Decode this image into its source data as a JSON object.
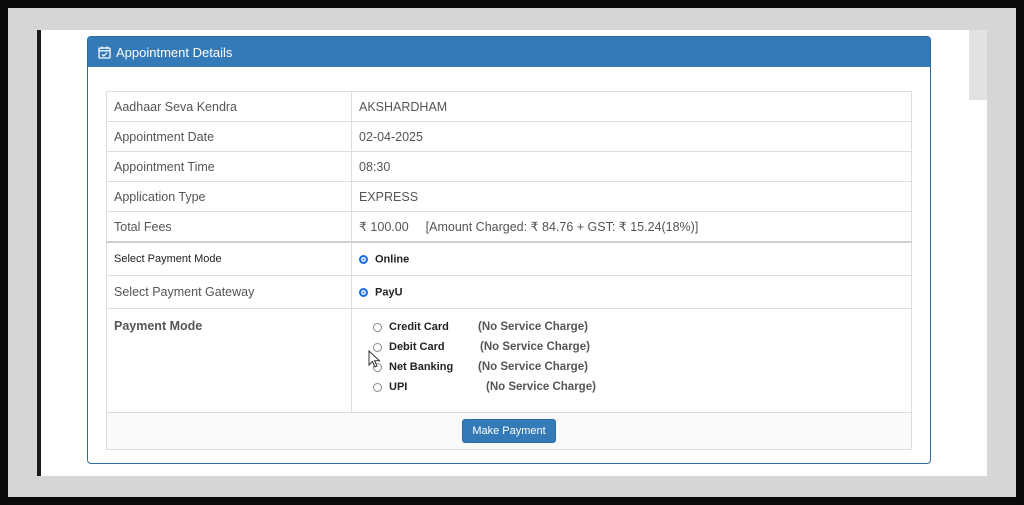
{
  "panel": {
    "title": "Appointment Details",
    "icon": "calendar-check-icon"
  },
  "details": [
    {
      "label": "Aadhaar Seva Kendra",
      "value": "AKSHARDHAM"
    },
    {
      "label": "Appointment Date",
      "value": "02-04-2025"
    },
    {
      "label": "Appointment Time",
      "value": "08:30"
    },
    {
      "label": "Application Type",
      "value": "EXPRESS"
    }
  ],
  "fees": {
    "label": "Total Fees",
    "amount": "₹ 100.00",
    "breakdown": "[Amount Charged: ₹ 84.76 + GST: ₹ 15.24(18%)]"
  },
  "payment_mode_select": {
    "label": "Select Payment Mode",
    "option": "Online",
    "selected": true
  },
  "gateway_select": {
    "label": "Select Payment Gateway",
    "option": "PayU",
    "selected": true
  },
  "payment_mode": {
    "label": "Payment Mode",
    "options": [
      {
        "name": "Credit Card",
        "charge": "(No Service Charge)",
        "selected": false
      },
      {
        "name": "Debit Card",
        "charge": "(No Service Charge)",
        "selected": false
      },
      {
        "name": "Net Banking",
        "charge": "(No Service Charge)",
        "selected": false
      },
      {
        "name": "UPI",
        "charge": "(No Service Charge)",
        "selected": false
      }
    ]
  },
  "actions": {
    "make_payment_label": "Make Payment"
  },
  "colors": {
    "header": "#337ab7",
    "radio_selected": "#1a6fe8"
  }
}
